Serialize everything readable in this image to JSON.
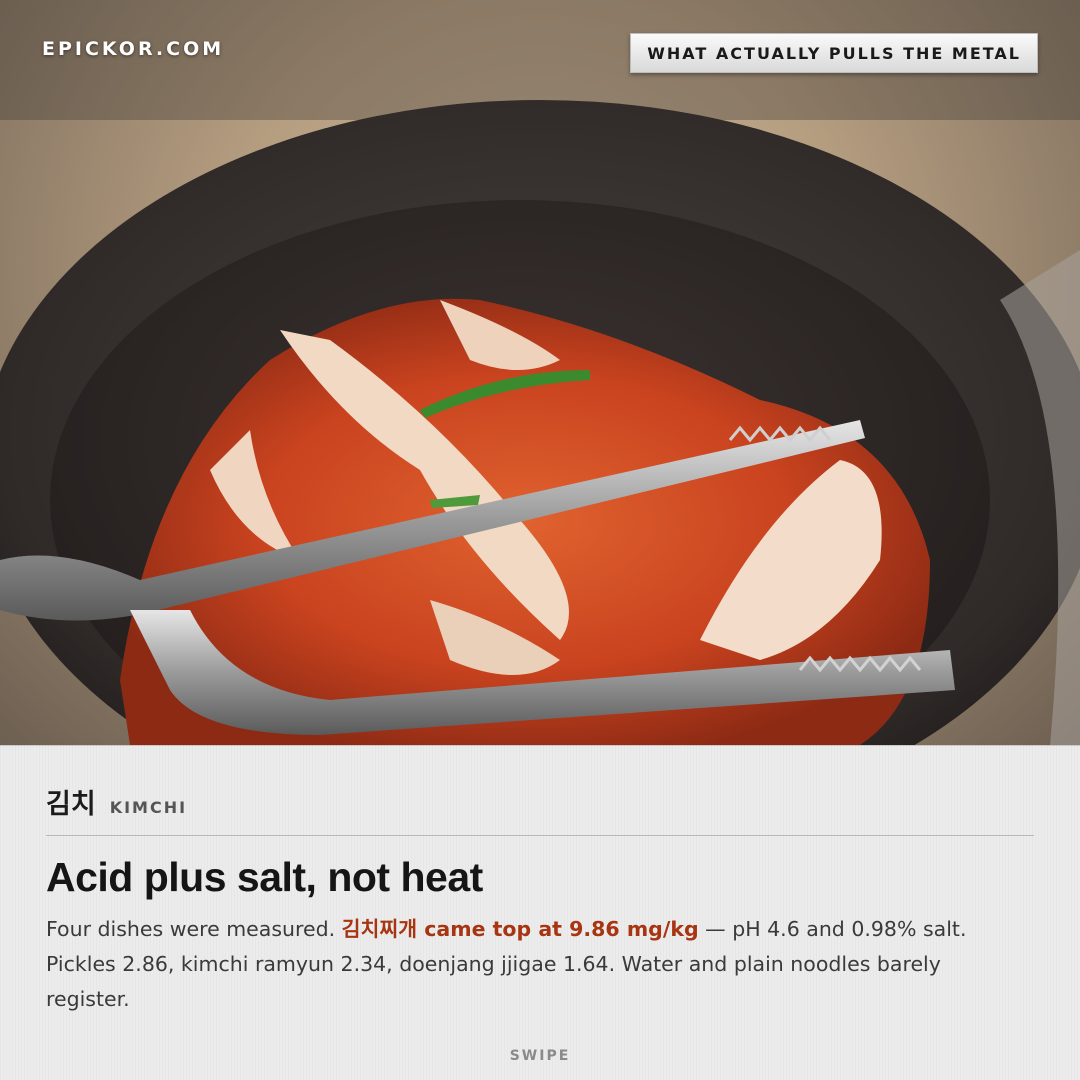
{
  "brand": {
    "site": "EPICKOR.COM"
  },
  "topic_tag": {
    "label": "WHAT ACTUALLY PULLS THE METAL"
  },
  "photo": {
    "subject_icon": "kimchi-bowl-with-tongs-image"
  },
  "dish": {
    "name_ko": "김치",
    "name_en": "KIMCHI"
  },
  "article": {
    "headline": "Acid plus salt, not heat",
    "body_pre": "Four dishes were measured. ",
    "body_highlight": "김치찌개 came top at 9.86 mg/kg",
    "body_post": " — pH 4.6 and 0.98% salt. Pickles 2.86, kimchi ramyun 2.34, doenjang jjigae 1.64. Water and plain noodles barely register."
  },
  "footer": {
    "swipe_label": "SWIPE"
  },
  "colors": {
    "accent": "#a83512",
    "panel": "#ececec",
    "headline": "#151515"
  }
}
